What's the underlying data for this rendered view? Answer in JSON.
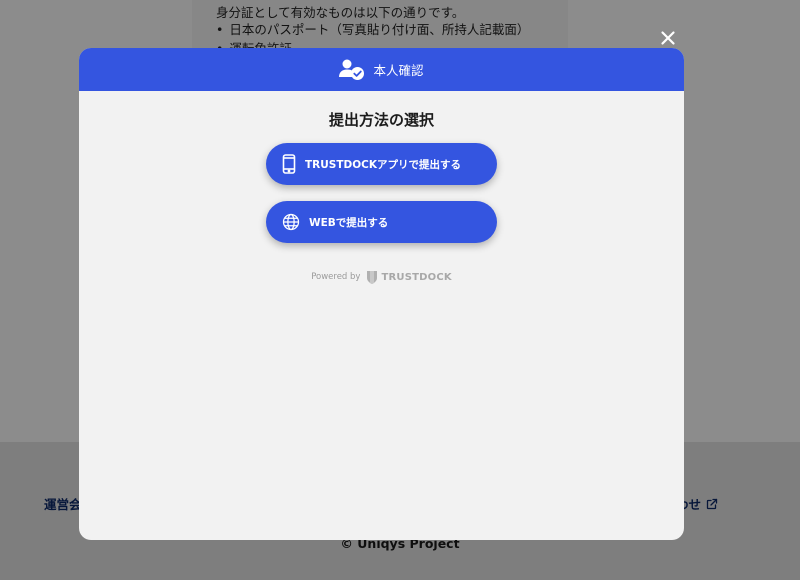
{
  "background": {
    "intro_text": "身分証として有効なものは以下の通りです。",
    "list_items": [
      "日本のパスポート（写真貼り付け面、所持人記載面）",
      "運転免許証"
    ],
    "footer": {
      "left_link": "運営会",
      "right_link": "わせ",
      "copyright": "© Uniqys Project"
    }
  },
  "modal": {
    "header_title": "本人確認",
    "title": "提出方法の選択",
    "buttons": {
      "app": "TRUSTDOCKアプリで提出する",
      "web": "WEBで提出する"
    },
    "powered_by": "Powered by",
    "brand_name": "TRUSTDOCK"
  },
  "colors": {
    "primary": "#3455e0",
    "overlay": "rgba(0,0,0,0.45)",
    "modal_bg": "#f2f2f2",
    "footer_link": "#0e2a6b"
  },
  "icons": {
    "header": "user-check-icon",
    "app_button": "smartphone-icon",
    "web_button": "globe-icon",
    "close": "close-icon",
    "external": "external-link-icon",
    "brand": "shield-icon"
  }
}
